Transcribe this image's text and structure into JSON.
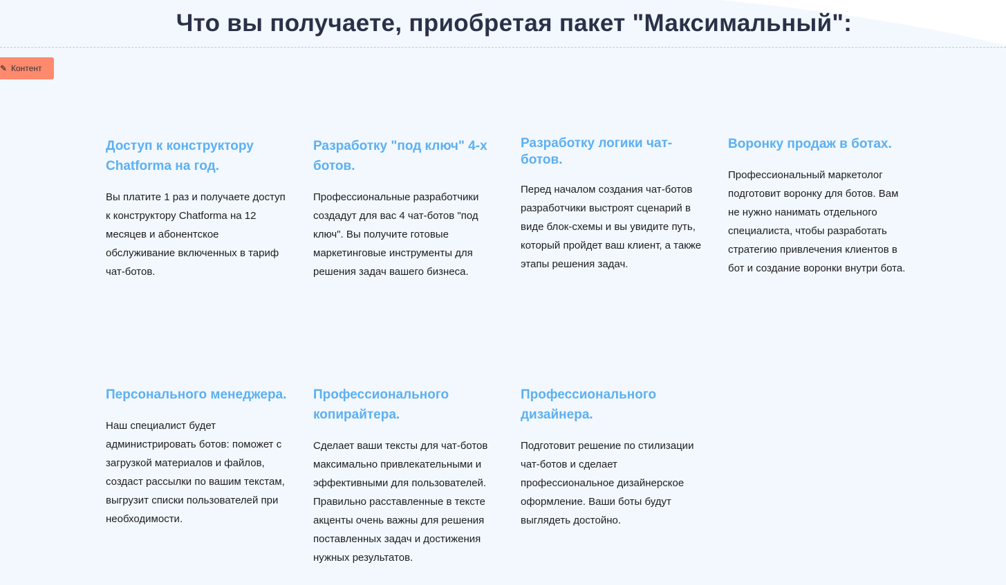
{
  "page": {
    "title": "Что вы получаете, приобретая пакет \"Максимальный\":"
  },
  "toolbar": {
    "content_label": "Контент",
    "icon": "pencil-icon"
  },
  "features": [
    {
      "title": "Доступ к конструктору Chatforma на год.",
      "text": "Вы платите 1 раз и получаете доступ к конструктору Chatforma на 12 месяцев и абонентское обслуживание включенных в тариф чат-ботов."
    },
    {
      "title": "Разработку \"под ключ\" 4-х ботов.",
      "text": "Профессиональные разработчики создадут для вас 4 чат-ботов \"под ключ\". Вы получите готовые маркетинговые инструменты для решения задач вашего бизнеса."
    },
    {
      "title": "Разработку логики чат-ботов.",
      "text": "Перед началом создания чат-ботов разработчики выстроят сценарий в виде блок-схемы и вы увидите путь, который пройдет ваш клиент, а также этапы решения задач."
    },
    {
      "title": "Воронку продаж в ботах.",
      "text": "Профессиональный маркетолог подготовит воронку для ботов. Вам не нужно нанимать отдельного специалиста, чтобы разработать стратегию привлечения клиентов в бот и создание воронки внутри бота."
    },
    {
      "title": "Персонального менеджера.",
      "text": "Наш специалист будет администрировать ботов: поможет с загрузкой материалов и файлов, создаст рассылки по вашим текстам, выгрузит списки пользователей при необходимости."
    },
    {
      "title": "Профессионального копирайтера.",
      "text": "Сделает ваши тексты для чат-ботов максимально привлекательными и эффективными для пользователей. Правильно расставленные в тексте акценты очень важны для решения поставленных задач и достижения нужных результатов."
    },
    {
      "title": "Профессионального дизайнера.",
      "text": "Подготовит решение по стилизации чат-ботов и сделает профессиональное дизайнерское оформление. Ваши боты будут выглядеть достойно."
    }
  ]
}
